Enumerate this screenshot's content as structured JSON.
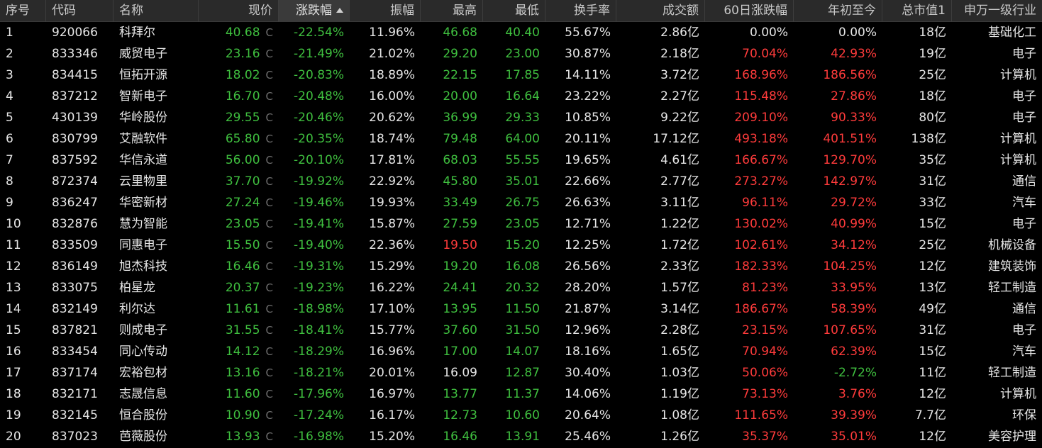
{
  "columns": {
    "idx": "序号",
    "code": "代码",
    "name": "名称",
    "price": "现价",
    "chg": "涨跌幅",
    "amp": "振幅",
    "high": "最高",
    "low": "最低",
    "turnover": "换手率",
    "volume": "成交额",
    "chg60": "60日涨跌幅",
    "ytd": "年初至今",
    "cap": "总市值1",
    "industry": "申万一级行业"
  },
  "colors": {
    "up": "#ff3b3b",
    "down": "#3fbf3f",
    "flat": "#e6e6e6"
  },
  "rows": [
    {
      "idx": "1",
      "code": "920066",
      "name": "科拜尔",
      "price": "40.68",
      "flag": "C",
      "chg": "-22.54%",
      "amp": "11.96%",
      "high": "46.68",
      "high_c": "green",
      "low": "40.40",
      "low_c": "green",
      "turnover": "55.67%",
      "volume": "2.86亿",
      "chg60": "0.00%",
      "chg60_c": "white",
      "ytd": "0.00%",
      "ytd_c": "white",
      "cap": "18亿",
      "industry": "基础化工"
    },
    {
      "idx": "2",
      "code": "833346",
      "name": "威贸电子",
      "price": "23.16",
      "flag": "C",
      "chg": "-21.49%",
      "amp": "21.02%",
      "high": "29.20",
      "high_c": "green",
      "low": "23.00",
      "low_c": "green",
      "turnover": "30.87%",
      "volume": "2.18亿",
      "chg60": "70.04%",
      "chg60_c": "red",
      "ytd": "42.93%",
      "ytd_c": "red",
      "cap": "19亿",
      "industry": "电子"
    },
    {
      "idx": "3",
      "code": "834415",
      "name": "恒拓开源",
      "price": "18.02",
      "flag": "C",
      "chg": "-20.83%",
      "amp": "18.89%",
      "high": "22.15",
      "high_c": "green",
      "low": "17.85",
      "low_c": "green",
      "turnover": "14.11%",
      "volume": "3.72亿",
      "chg60": "168.96%",
      "chg60_c": "red",
      "ytd": "186.56%",
      "ytd_c": "red",
      "cap": "25亿",
      "industry": "计算机"
    },
    {
      "idx": "4",
      "code": "837212",
      "name": "智新电子",
      "price": "16.70",
      "flag": "C",
      "chg": "-20.48%",
      "amp": "16.00%",
      "high": "20.00",
      "high_c": "green",
      "low": "16.64",
      "low_c": "green",
      "turnover": "23.22%",
      "volume": "2.27亿",
      "chg60": "115.48%",
      "chg60_c": "red",
      "ytd": "27.86%",
      "ytd_c": "red",
      "cap": "18亿",
      "industry": "电子"
    },
    {
      "idx": "5",
      "code": "430139",
      "name": "华岭股份",
      "price": "29.55",
      "flag": "C",
      "chg": "-20.46%",
      "amp": "20.62%",
      "high": "36.99",
      "high_c": "green",
      "low": "29.33",
      "low_c": "green",
      "turnover": "10.85%",
      "volume": "9.22亿",
      "chg60": "209.10%",
      "chg60_c": "red",
      "ytd": "90.33%",
      "ytd_c": "red",
      "cap": "80亿",
      "industry": "电子"
    },
    {
      "idx": "6",
      "code": "830799",
      "name": "艾融软件",
      "price": "65.80",
      "flag": "C",
      "chg": "-20.35%",
      "amp": "18.74%",
      "high": "79.48",
      "high_c": "green",
      "low": "64.00",
      "low_c": "green",
      "turnover": "20.11%",
      "volume": "17.12亿",
      "chg60": "493.18%",
      "chg60_c": "red",
      "ytd": "401.51%",
      "ytd_c": "red",
      "cap": "138亿",
      "industry": "计算机"
    },
    {
      "idx": "7",
      "code": "837592",
      "name": "华信永道",
      "price": "56.00",
      "flag": "C",
      "chg": "-20.10%",
      "amp": "17.81%",
      "high": "68.03",
      "high_c": "green",
      "low": "55.55",
      "low_c": "green",
      "turnover": "19.65%",
      "volume": "4.61亿",
      "chg60": "166.67%",
      "chg60_c": "red",
      "ytd": "129.70%",
      "ytd_c": "red",
      "cap": "35亿",
      "industry": "计算机"
    },
    {
      "idx": "8",
      "code": "872374",
      "name": "云里物里",
      "price": "37.70",
      "flag": "C",
      "chg": "-19.92%",
      "amp": "22.92%",
      "high": "45.80",
      "high_c": "green",
      "low": "35.01",
      "low_c": "green",
      "turnover": "22.66%",
      "volume": "2.77亿",
      "chg60": "273.27%",
      "chg60_c": "red",
      "ytd": "142.97%",
      "ytd_c": "red",
      "cap": "31亿",
      "industry": "通信"
    },
    {
      "idx": "9",
      "code": "836247",
      "name": "华密新材",
      "price": "27.24",
      "flag": "C",
      "chg": "-19.46%",
      "amp": "19.93%",
      "high": "33.49",
      "high_c": "green",
      "low": "26.75",
      "low_c": "green",
      "turnover": "26.63%",
      "volume": "3.11亿",
      "chg60": "96.11%",
      "chg60_c": "red",
      "ytd": "29.72%",
      "ytd_c": "red",
      "cap": "33亿",
      "industry": "汽车"
    },
    {
      "idx": "10",
      "code": "832876",
      "name": "慧为智能",
      "price": "23.05",
      "flag": "C",
      "chg": "-19.41%",
      "amp": "15.87%",
      "high": "27.59",
      "high_c": "green",
      "low": "23.05",
      "low_c": "green",
      "turnover": "12.71%",
      "volume": "1.22亿",
      "chg60": "130.02%",
      "chg60_c": "red",
      "ytd": "40.99%",
      "ytd_c": "red",
      "cap": "15亿",
      "industry": "电子"
    },
    {
      "idx": "11",
      "code": "833509",
      "name": "同惠电子",
      "price": "15.50",
      "flag": "C",
      "chg": "-19.40%",
      "amp": "22.36%",
      "high": "19.50",
      "high_c": "red",
      "low": "15.20",
      "low_c": "green",
      "turnover": "12.25%",
      "volume": "1.72亿",
      "chg60": "102.61%",
      "chg60_c": "red",
      "ytd": "34.12%",
      "ytd_c": "red",
      "cap": "25亿",
      "industry": "机械设备"
    },
    {
      "idx": "12",
      "code": "836149",
      "name": "旭杰科技",
      "price": "16.46",
      "flag": "C",
      "chg": "-19.31%",
      "amp": "15.29%",
      "high": "19.20",
      "high_c": "green",
      "low": "16.08",
      "low_c": "green",
      "turnover": "26.56%",
      "volume": "2.33亿",
      "chg60": "182.33%",
      "chg60_c": "red",
      "ytd": "104.25%",
      "ytd_c": "red",
      "cap": "12亿",
      "industry": "建筑装饰"
    },
    {
      "idx": "13",
      "code": "833075",
      "name": "柏星龙",
      "price": "20.37",
      "flag": "C",
      "chg": "-19.23%",
      "amp": "16.22%",
      "high": "24.41",
      "high_c": "green",
      "low": "20.32",
      "low_c": "green",
      "turnover": "28.20%",
      "volume": "1.57亿",
      "chg60": "81.23%",
      "chg60_c": "red",
      "ytd": "33.95%",
      "ytd_c": "red",
      "cap": "13亿",
      "industry": "轻工制造"
    },
    {
      "idx": "14",
      "code": "832149",
      "name": "利尔达",
      "price": "11.61",
      "flag": "C",
      "chg": "-18.98%",
      "amp": "17.10%",
      "high": "13.95",
      "high_c": "green",
      "low": "11.50",
      "low_c": "green",
      "turnover": "21.87%",
      "volume": "3.14亿",
      "chg60": "186.67%",
      "chg60_c": "red",
      "ytd": "58.39%",
      "ytd_c": "red",
      "cap": "49亿",
      "industry": "通信"
    },
    {
      "idx": "15",
      "code": "837821",
      "name": "则成电子",
      "price": "31.55",
      "flag": "C",
      "chg": "-18.41%",
      "amp": "15.77%",
      "high": "37.60",
      "high_c": "green",
      "low": "31.50",
      "low_c": "green",
      "turnover": "12.96%",
      "volume": "2.28亿",
      "chg60": "23.15%",
      "chg60_c": "red",
      "ytd": "107.65%",
      "ytd_c": "red",
      "cap": "31亿",
      "industry": "电子"
    },
    {
      "idx": "16",
      "code": "833454",
      "name": "同心传动",
      "price": "14.12",
      "flag": "C",
      "chg": "-18.29%",
      "amp": "16.96%",
      "high": "17.00",
      "high_c": "green",
      "low": "14.07",
      "low_c": "green",
      "turnover": "18.16%",
      "volume": "1.65亿",
      "chg60": "70.94%",
      "chg60_c": "red",
      "ytd": "62.39%",
      "ytd_c": "red",
      "cap": "15亿",
      "industry": "汽车"
    },
    {
      "idx": "17",
      "code": "837174",
      "name": "宏裕包材",
      "price": "13.16",
      "flag": "C",
      "chg": "-18.21%",
      "amp": "20.01%",
      "high": "16.09",
      "high_c": "white",
      "low": "12.87",
      "low_c": "green",
      "turnover": "30.40%",
      "volume": "1.03亿",
      "chg60": "50.06%",
      "chg60_c": "red",
      "ytd": "-2.72%",
      "ytd_c": "green",
      "cap": "11亿",
      "industry": "轻工制造"
    },
    {
      "idx": "18",
      "code": "832171",
      "name": "志晟信息",
      "price": "11.60",
      "flag": "C",
      "chg": "-17.96%",
      "amp": "16.97%",
      "high": "13.77",
      "high_c": "green",
      "low": "11.37",
      "low_c": "green",
      "turnover": "14.06%",
      "volume": "1.19亿",
      "chg60": "73.13%",
      "chg60_c": "red",
      "ytd": "3.76%",
      "ytd_c": "red",
      "cap": "12亿",
      "industry": "计算机"
    },
    {
      "idx": "19",
      "code": "832145",
      "name": "恒合股份",
      "price": "10.90",
      "flag": "C",
      "chg": "-17.24%",
      "amp": "16.17%",
      "high": "12.73",
      "high_c": "green",
      "low": "10.60",
      "low_c": "green",
      "turnover": "20.64%",
      "volume": "1.08亿",
      "chg60": "111.65%",
      "chg60_c": "red",
      "ytd": "39.39%",
      "ytd_c": "red",
      "cap": "7.7亿",
      "industry": "环保"
    },
    {
      "idx": "20",
      "code": "837023",
      "name": "芭薇股份",
      "price": "13.93",
      "flag": "C",
      "chg": "-16.98%",
      "amp": "15.20%",
      "high": "16.46",
      "high_c": "green",
      "low": "13.91",
      "low_c": "green",
      "turnover": "25.46%",
      "volume": "1.26亿",
      "chg60": "35.37%",
      "chg60_c": "red",
      "ytd": "35.01%",
      "ytd_c": "red",
      "cap": "12亿",
      "industry": "美容护理"
    }
  ]
}
